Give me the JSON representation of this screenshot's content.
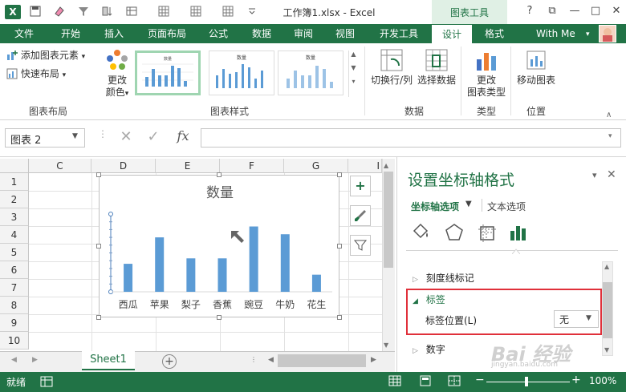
{
  "titlebar": {
    "app_icon": "X",
    "title": "工作簿1.xlsx - Excel",
    "contextual_tab_group": "图表工具",
    "window_controls": [
      "?",
      "⧉",
      "—",
      "□",
      "✕"
    ]
  },
  "tabs": [
    "文件",
    "开始",
    "插入",
    "页面布局",
    "公式",
    "数据",
    "审阅",
    "视图",
    "开发工具",
    "设计",
    "格式"
  ],
  "active_tab": "设计",
  "user": {
    "name": "With Me"
  },
  "ribbon": {
    "add_chart_element": "添加图表元素",
    "quick_layout": "快速布局",
    "change_colors_line1": "更改",
    "change_colors_line2": "颜色",
    "group_chart_layouts": "图表布局",
    "group_chart_styles": "图表样式",
    "style_thumbnail_title": "数量",
    "switch_row_col": "切换行/列",
    "select_data": "选择数据",
    "group_data": "数据",
    "change_type_line1": "更改",
    "change_type_line2": "图表类型",
    "group_type": "类型",
    "move_chart": "移动图表",
    "group_location": "位置"
  },
  "formula_bar": {
    "name_box": "图表 2",
    "cancel": "✕",
    "enter": "✓",
    "fx": "fx",
    "formula": ""
  },
  "grid": {
    "columns": [
      "C",
      "D",
      "E",
      "F",
      "G",
      "I"
    ],
    "rows": [
      "1",
      "2",
      "3",
      "4",
      "5",
      "6",
      "7",
      "8",
      "9",
      "10"
    ]
  },
  "chart": {
    "side_buttons": [
      "+",
      "✎",
      "⊽"
    ],
    "chart_data": {
      "type": "bar",
      "title": "数量",
      "categories": [
        "西瓜",
        "苹果",
        "梨子",
        "香蕉",
        "豌豆",
        "牛奶",
        "花生"
      ],
      "values": [
        36,
        70,
        43,
        43,
        84,
        74,
        22
      ],
      "ylim": [
        0,
        100
      ],
      "xlabel": "",
      "ylabel": "",
      "grid": false,
      "color": "#5b9bd5"
    }
  },
  "sheets": {
    "active": "Sheet1",
    "add": "+"
  },
  "pane": {
    "title": "设置坐标轴格式",
    "tab_axis_options": "坐标轴选项",
    "tab_text_options": "文本选项",
    "sections": {
      "tick_marks": "刻度线标记",
      "labels": "标签",
      "label_position_label": "标签位置(L)",
      "label_position_value": "无",
      "number": "数字"
    },
    "close": "✕",
    "pin": "▾"
  },
  "statusbar": {
    "ready": "就绪",
    "zoom": "100%",
    "zoom_minus": "−",
    "zoom_plus": "+"
  },
  "watermark": {
    "text": "Bai 经验",
    "sub": "jingyan.baidu.com"
  },
  "colors": {
    "accent": "#217346",
    "highlight": "#e0303a",
    "bar": "#5b9bd5"
  }
}
